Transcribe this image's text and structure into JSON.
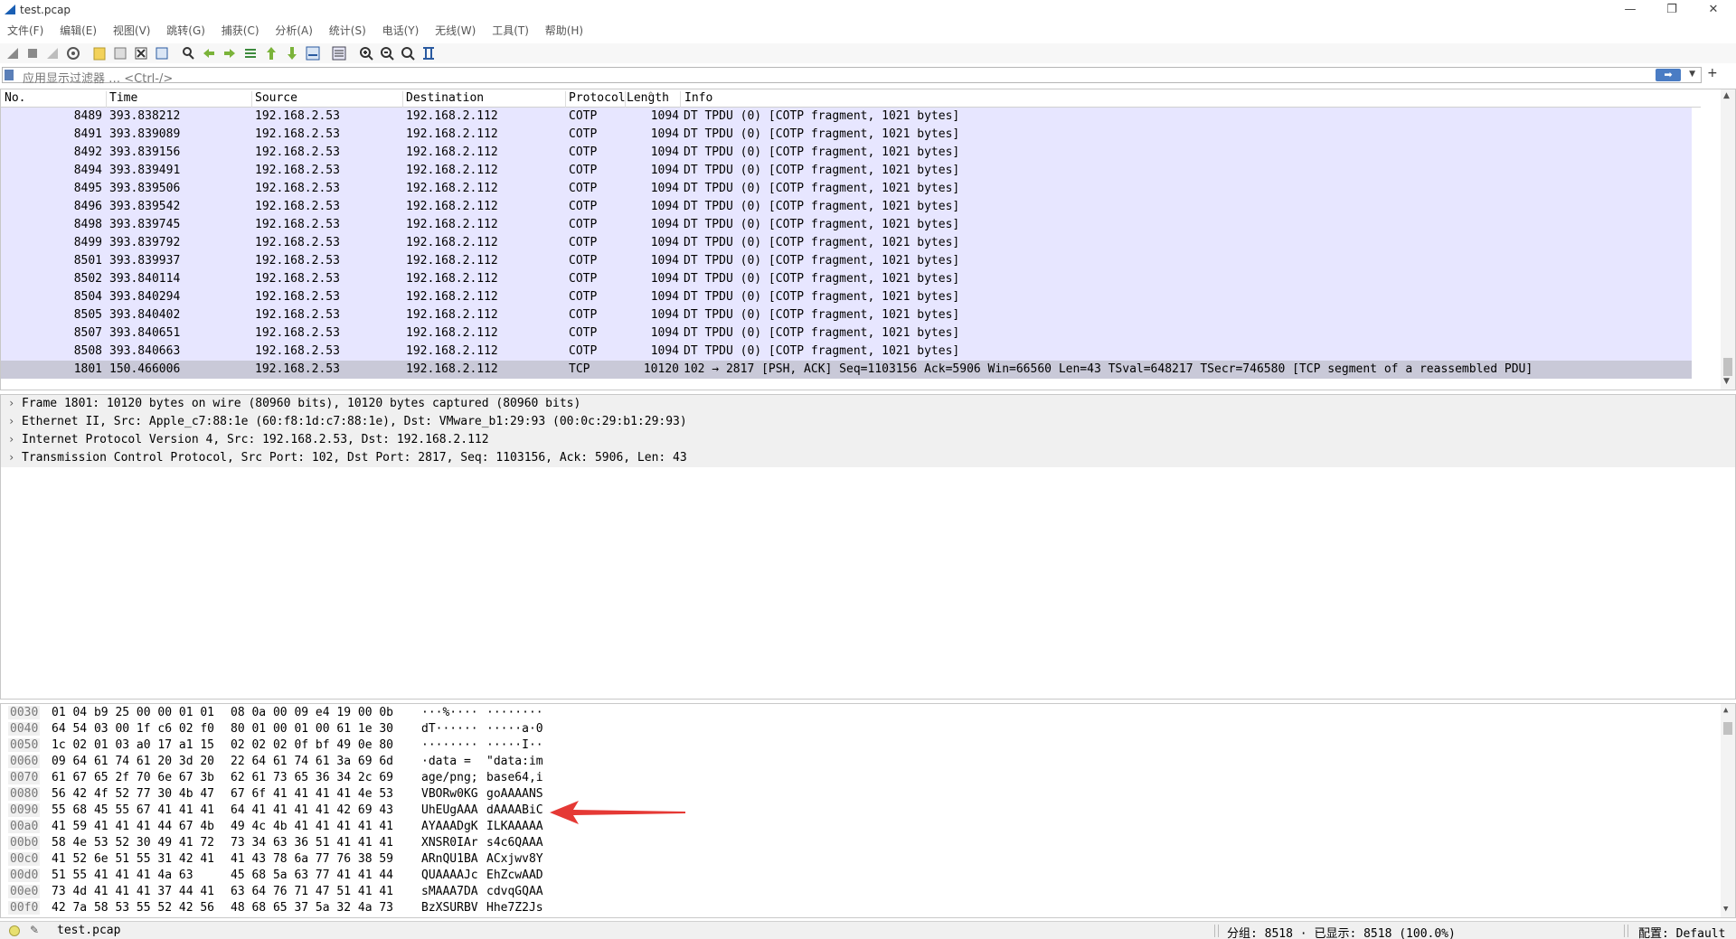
{
  "window": {
    "title": "test.pcap",
    "minimize": "—",
    "restore": "❐",
    "close": "✕"
  },
  "menu": [
    "文件(F)",
    "编辑(E)",
    "视图(V)",
    "跳转(G)",
    "捕获(C)",
    "分析(A)",
    "统计(S)",
    "电话(Y)",
    "无线(W)",
    "工具(T)",
    "帮助(H)"
  ],
  "filter": {
    "placeholder": "应用显示过滤器 … <Ctrl-/>",
    "apply_icon": "arrow-right-icon",
    "add_label": "+"
  },
  "packet_list": {
    "columns": [
      "No.",
      "Time",
      "Source",
      "Destination",
      "Protocol",
      "Length",
      "Info"
    ],
    "rows": [
      {
        "no": "8489",
        "time": "393.838212",
        "src": "192.168.2.53",
        "dst": "192.168.2.112",
        "proto": "COTP",
        "len": "1094",
        "info": "DT TPDU (0) [COTP fragment, 1021 bytes]"
      },
      {
        "no": "8491",
        "time": "393.839089",
        "src": "192.168.2.53",
        "dst": "192.168.2.112",
        "proto": "COTP",
        "len": "1094",
        "info": "DT TPDU (0) [COTP fragment, 1021 bytes]"
      },
      {
        "no": "8492",
        "time": "393.839156",
        "src": "192.168.2.53",
        "dst": "192.168.2.112",
        "proto": "COTP",
        "len": "1094",
        "info": "DT TPDU (0) [COTP fragment, 1021 bytes]"
      },
      {
        "no": "8494",
        "time": "393.839491",
        "src": "192.168.2.53",
        "dst": "192.168.2.112",
        "proto": "COTP",
        "len": "1094",
        "info": "DT TPDU (0) [COTP fragment, 1021 bytes]"
      },
      {
        "no": "8495",
        "time": "393.839506",
        "src": "192.168.2.53",
        "dst": "192.168.2.112",
        "proto": "COTP",
        "len": "1094",
        "info": "DT TPDU (0) [COTP fragment, 1021 bytes]"
      },
      {
        "no": "8496",
        "time": "393.839542",
        "src": "192.168.2.53",
        "dst": "192.168.2.112",
        "proto": "COTP",
        "len": "1094",
        "info": "DT TPDU (0) [COTP fragment, 1021 bytes]"
      },
      {
        "no": "8498",
        "time": "393.839745",
        "src": "192.168.2.53",
        "dst": "192.168.2.112",
        "proto": "COTP",
        "len": "1094",
        "info": "DT TPDU (0) [COTP fragment, 1021 bytes]"
      },
      {
        "no": "8499",
        "time": "393.839792",
        "src": "192.168.2.53",
        "dst": "192.168.2.112",
        "proto": "COTP",
        "len": "1094",
        "info": "DT TPDU (0) [COTP fragment, 1021 bytes]"
      },
      {
        "no": "8501",
        "time": "393.839937",
        "src": "192.168.2.53",
        "dst": "192.168.2.112",
        "proto": "COTP",
        "len": "1094",
        "info": "DT TPDU (0) [COTP fragment, 1021 bytes]"
      },
      {
        "no": "8502",
        "time": "393.840114",
        "src": "192.168.2.53",
        "dst": "192.168.2.112",
        "proto": "COTP",
        "len": "1094",
        "info": "DT TPDU (0) [COTP fragment, 1021 bytes]"
      },
      {
        "no": "8504",
        "time": "393.840294",
        "src": "192.168.2.53",
        "dst": "192.168.2.112",
        "proto": "COTP",
        "len": "1094",
        "info": "DT TPDU (0) [COTP fragment, 1021 bytes]"
      },
      {
        "no": "8505",
        "time": "393.840402",
        "src": "192.168.2.53",
        "dst": "192.168.2.112",
        "proto": "COTP",
        "len": "1094",
        "info": "DT TPDU (0) [COTP fragment, 1021 bytes]"
      },
      {
        "no": "8507",
        "time": "393.840651",
        "src": "192.168.2.53",
        "dst": "192.168.2.112",
        "proto": "COTP",
        "len": "1094",
        "info": "DT TPDU (0) [COTP fragment, 1021 bytes]"
      },
      {
        "no": "8508",
        "time": "393.840663",
        "src": "192.168.2.53",
        "dst": "192.168.2.112",
        "proto": "COTP",
        "len": "1094",
        "info": "DT TPDU (0) [COTP fragment, 1021 bytes]"
      },
      {
        "no": "1801",
        "time": "150.466006",
        "src": "192.168.2.53",
        "dst": "192.168.2.112",
        "proto": "TCP",
        "len": "10120",
        "info": "102 → 2817 [PSH, ACK] Seq=1103156 Ack=5906 Win=66560 Len=43 TSval=648217 TSecr=746580 [TCP segment of a reassembled PDU]"
      }
    ]
  },
  "details": [
    "Frame 1801: 10120 bytes on wire (80960 bits), 10120 bytes captured (80960 bits)",
    "Ethernet II, Src: Apple_c7:88:1e (60:f8:1d:c7:88:1e), Dst: VMware_b1:29:93 (00:0c:29:b1:29:93)",
    "Internet Protocol Version 4, Src: 192.168.2.53, Dst: 192.168.2.112",
    "Transmission Control Protocol, Src Port: 102, Dst Port: 2817, Seq: 1103156, Ack: 5906, Len: 43"
  ],
  "bytes": [
    {
      "off": "0030",
      "h1": "01 04 b9 25 00 00 01 01",
      "h2": "08 0a 00 09 e4 19 00 0b",
      "a1": "···%····",
      "a2": "········"
    },
    {
      "off": "0040",
      "h1": "64 54 03 00 1f c6 02 f0",
      "h2": "80 01 00 01 00 61 1e 30",
      "a1": "dT······",
      "a2": "·····a·0"
    },
    {
      "off": "0050",
      "h1": "1c 02 01 03 a0 17 a1 15",
      "h2": "02 02 02 0f bf 49 0e 80",
      "a1": "········",
      "a2": "·····I··"
    },
    {
      "off": "0060",
      "h1": "09 64 61 74 61 20 3d 20",
      "h2": "22 64 61 74 61 3a 69 6d",
      "a1": "·data = ",
      "a2": "\"data:im"
    },
    {
      "off": "0070",
      "h1": "61 67 65 2f 70 6e 67 3b",
      "h2": "62 61 73 65 36 34 2c 69",
      "a1": "age/png;",
      "a2": "base64,i"
    },
    {
      "off": "0080",
      "h1": "56 42 4f 52 77 30 4b 47",
      "h2": "67 6f 41 41 41 41 4e 53",
      "a1": "VBORw0KG",
      "a2": "goAAAANS"
    },
    {
      "off": "0090",
      "h1": "55 68 45 55 67 41 41 41",
      "h2": "64 41 41 41 41 42 69 43",
      "a1": "UhEUgAAA",
      "a2": "dAAAABiC"
    },
    {
      "off": "00a0",
      "h1": "41 59 41 41 41 44 67 4b",
      "h2": "49 4c 4b 41 41 41 41 41",
      "a1": "AYAAADgK",
      "a2": "ILKAAAAA"
    },
    {
      "off": "00b0",
      "h1": "58 4e 53 52 30 49 41 72",
      "h2": "73 34 63 36 51 41 41 41",
      "a1": "XNSR0IAr",
      "a2": "s4c6QAAA"
    },
    {
      "off": "00c0",
      "h1": "41 52 6e 51 55 31 42 41",
      "h2": "41 43 78 6a 77 76 38 59",
      "a1": "ARnQU1BA",
      "a2": "ACxjwv8Y"
    },
    {
      "off": "00d0",
      "h1": "51 55 41 41 41 4a 63",
      "h2": "45 68 5a 63 77 41 41 44",
      "a1": "QUAAAAJc",
      "a2": "EhZcwAAD"
    },
    {
      "off": "00e0",
      "h1": "73 4d 41 41 41 37 44 41",
      "h2": "63 64 76 71 47 51 41 41",
      "a1": "sMAAA7DA",
      "a2": "cdvqGQAA"
    },
    {
      "off": "00f0",
      "h1": "42 7a 58 53 55 52 42 56",
      "h2": "48 68 65 37 5a 32 4a 73",
      "a1": "BzXSURBV",
      "a2": "Hhe7Z2Js"
    }
  ],
  "status": {
    "file": "test.pcap",
    "packets": "分组: 8518 · 已显示: 8518 (100.0%)",
    "profile": "配置: Default"
  },
  "colors": {
    "row_bg": "#e7e6ff",
    "selected_bg": "#c9c9d8",
    "annotation_arrow": "#e53935"
  }
}
